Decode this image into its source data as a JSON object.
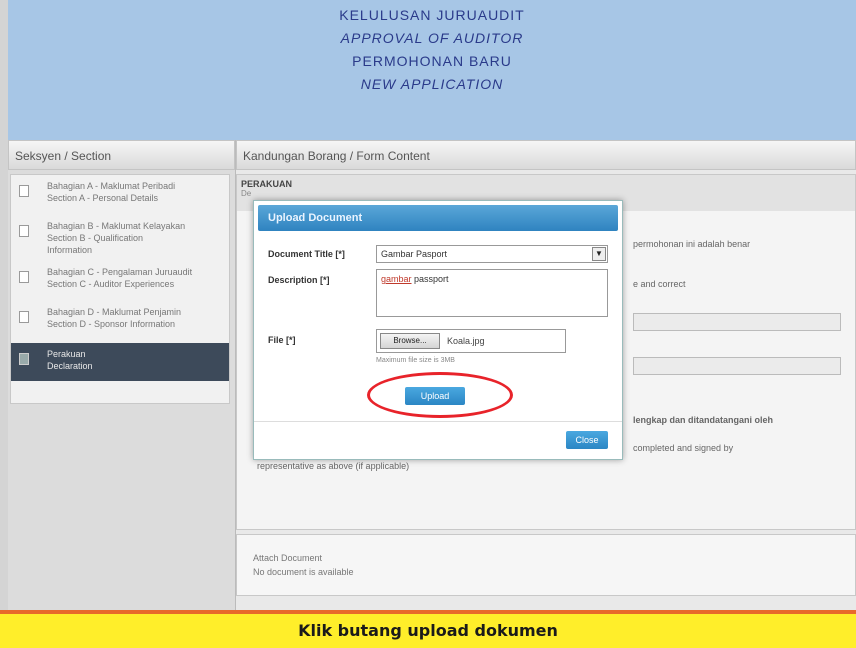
{
  "header": {
    "line1": "KELULUSAN JURUAUDIT",
    "line2": "APPROVAL OF AUDITOR",
    "line3": "PERMOHONAN BARU",
    "line4": "NEW APPLICATION"
  },
  "sidebar": {
    "title": "Seksyen / Section",
    "items": [
      {
        "line1": "Bahagian A - Maklumat Peribadi",
        "line2": "Section A - Personal Details"
      },
      {
        "line1": "Bahagian B - Maklumat Kelayakan",
        "line2": "Section B - Qualification",
        "line3": "Information"
      },
      {
        "line1": "Bahagian C - Pengalaman Juruaudit",
        "line2": "Section C - Auditor Experiences"
      },
      {
        "line1": "Bahagian D - Maklumat Penjamin",
        "line2": "Section D - Sponsor Information"
      },
      {
        "line1": "Perakuan",
        "line2": "Declaration"
      }
    ]
  },
  "main": {
    "title": "Kandungan Borang / Form Content",
    "section_title": "PERAKUAN",
    "section_sub": "De",
    "bg_text_1": "permohonan ini adalah benar",
    "bg_text_2": "e and correct",
    "bg_text_3": "lengkap dan ditandatangani oleh",
    "bg_text_4": "completed and signed by",
    "bg_text_5": "representative as above (if applicable)"
  },
  "modal": {
    "title": "Upload Document",
    "doc_title_label": "Document Title [*]",
    "doc_title_value": "Gambar Pasport",
    "description_label": "Description [*]",
    "description_red": "gambar",
    "description_rest": " passport",
    "file_label": "File [*]",
    "browse_label": "Browse...",
    "file_name": "Koala.jpg",
    "hint": "Maximum file size is 3MB",
    "upload_label": "Upload",
    "close_label": "Close"
  },
  "attach": {
    "title": "Attach Document",
    "empty": "No document is available"
  },
  "banner": {
    "text": "Klik butang upload dokumen"
  },
  "colors": {
    "header_bg": "#a7c6e6",
    "accent_blue": "#2b86c4",
    "highlight_red": "#e8232a",
    "banner_yellow": "#ffee2a"
  }
}
